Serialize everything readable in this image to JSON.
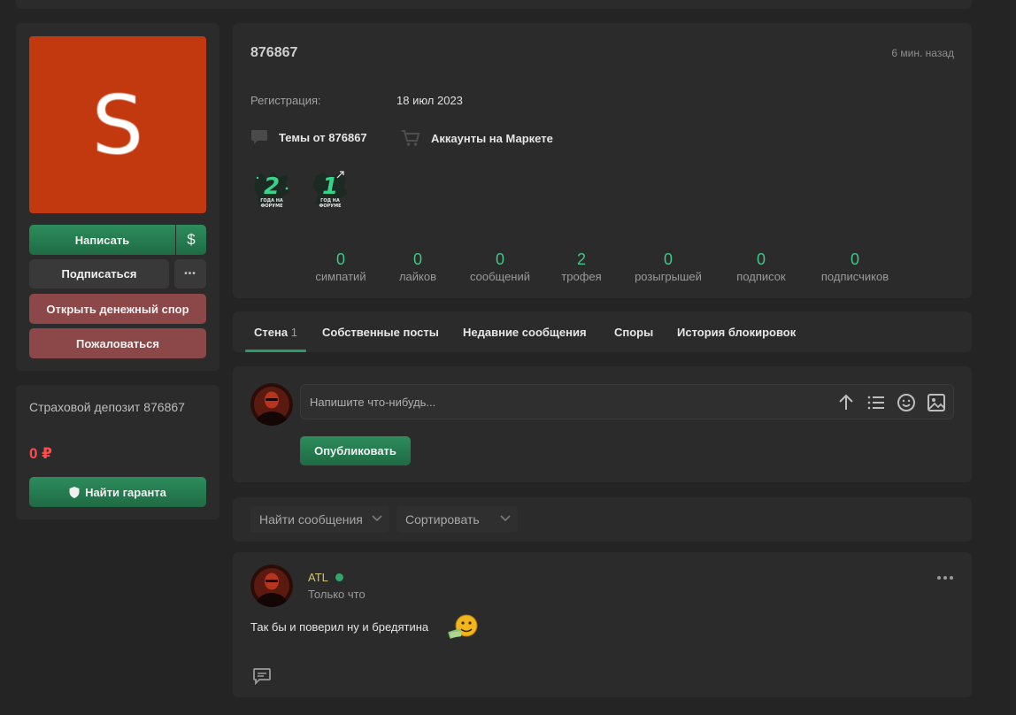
{
  "left": {
    "avatar_letter": "S",
    "write_label": "Написать",
    "money_icon": "$",
    "subscribe_label": "Подписаться",
    "more_icon": "•••",
    "dispute_label": "Открыть денежный спор",
    "report_label": "Пожаловаться"
  },
  "deposit": {
    "title": "Страховой депозит 876867",
    "amount": "0 ₽",
    "guarantor_label": "Найти гаранта"
  },
  "profile": {
    "username": "876867",
    "last_seen": "6 мин. назад",
    "reg_label": "Регистрация:",
    "reg_value": "18 июл 2023",
    "topics_label": "Темы от 876867",
    "market_label": "Аккаунты на Маркете",
    "trophies": [
      {
        "num": "2",
        "caption1": "ГОДА НА",
        "caption2": "ФОРУМЕ"
      },
      {
        "num": "1",
        "caption1": "ГОД НА",
        "caption2": "ФОРУМЕ"
      }
    ],
    "stats": [
      {
        "value": "0",
        "label": "симпатий"
      },
      {
        "value": "0",
        "label": "лайков"
      },
      {
        "value": "0",
        "label": "сообщений"
      },
      {
        "value": "2",
        "label": "трофея"
      },
      {
        "value": "0",
        "label": "розыгрышей"
      },
      {
        "value": "0",
        "label": "подписок"
      },
      {
        "value": "0",
        "label": "подписчиков"
      }
    ]
  },
  "tabs": [
    {
      "label": "Стена",
      "count": "1"
    },
    {
      "label": "Собственные посты",
      "count": ""
    },
    {
      "label": "Недавние сообщения",
      "count": ""
    },
    {
      "label": "Споры",
      "count": ""
    },
    {
      "label": "История блокировок",
      "count": ""
    }
  ],
  "composer": {
    "placeholder": "Напишите что-нибудь...",
    "publish_label": "Опубликовать"
  },
  "filters": {
    "find_label": "Найти сообщения",
    "sort_label": "Сортировать"
  },
  "post": {
    "author": "ATL",
    "time": "Только что",
    "text": "Так бы и поверил ну и бредятина"
  },
  "colors": {
    "accent_green": "#2a9d65",
    "stat_green": "#3ec786",
    "avatar_orange": "#c3390f",
    "danger_red": "#ff4b4b"
  }
}
